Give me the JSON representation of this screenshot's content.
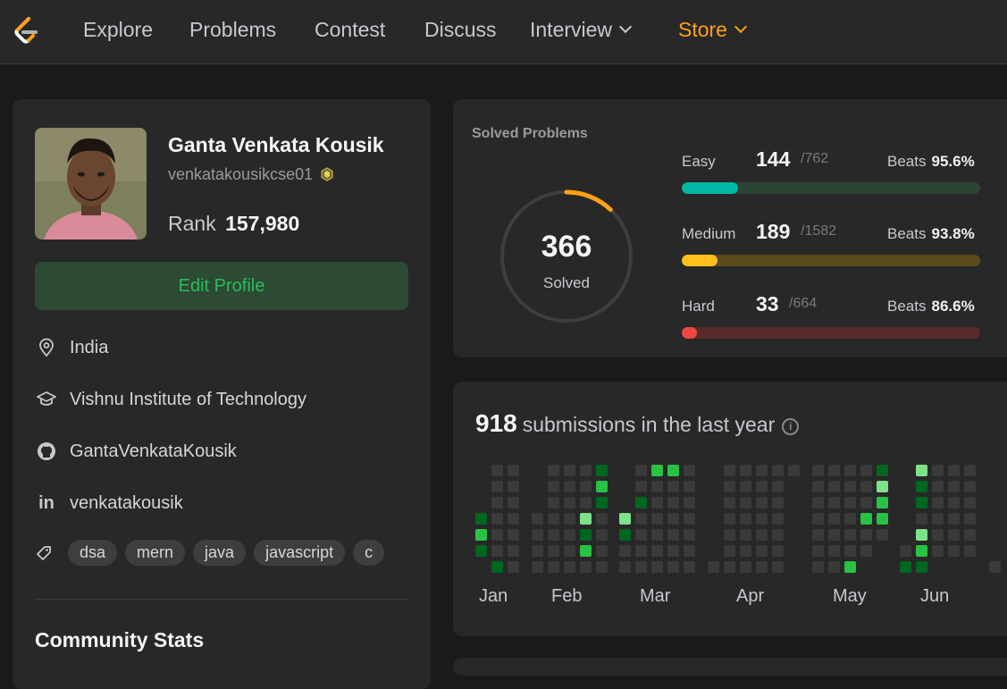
{
  "nav": {
    "items": [
      {
        "label": "Explore"
      },
      {
        "label": "Problems"
      },
      {
        "label": "Contest"
      },
      {
        "label": "Discuss"
      },
      {
        "label": "Interview"
      },
      {
        "label": "Store"
      }
    ],
    "accent_color": "#ffa116"
  },
  "profile": {
    "name": "Ganta Venkata Kousik",
    "username": "venkatakousikcse01",
    "rank_label": "Rank",
    "rank_value": "157,980",
    "edit_button": "Edit Profile",
    "location": "India",
    "institution": "Vishnu Institute of Technology",
    "github": "GantaVenkataKousik",
    "linkedin": "venkatakousik",
    "tags": [
      "dsa",
      "mern",
      "java",
      "javascript",
      "c"
    ],
    "community_title": "Community Stats"
  },
  "solved": {
    "title": "Solved Problems",
    "total": "366",
    "total_label": "Solved",
    "difficulties": [
      {
        "label": "Easy",
        "count": "144",
        "total": "/762",
        "beats_label": "Beats",
        "beats": "95.6%",
        "fraction": 0.189,
        "fill_color": "#00b8a3",
        "track_color": "#2b4434"
      },
      {
        "label": "Medium",
        "count": "189",
        "total": "/1582",
        "beats_label": "Beats",
        "beats": "93.8%",
        "fraction": 0.119,
        "fill_color": "#ffc01e",
        "track_color": "#5a4a1c"
      },
      {
        "label": "Hard",
        "count": "33",
        "total": "/664",
        "beats_label": "Beats",
        "beats": "86.6%",
        "fraction": 0.05,
        "fill_color": "#ef4743",
        "track_color": "#5a2a2a"
      }
    ],
    "ring_fraction": 0.12
  },
  "submissions": {
    "count": "918",
    "text": "submissions in the last year",
    "info_icon": "i",
    "months": [
      "Jan",
      "Feb",
      "Mar",
      "Apr",
      "May",
      "Jun"
    ]
  }
}
